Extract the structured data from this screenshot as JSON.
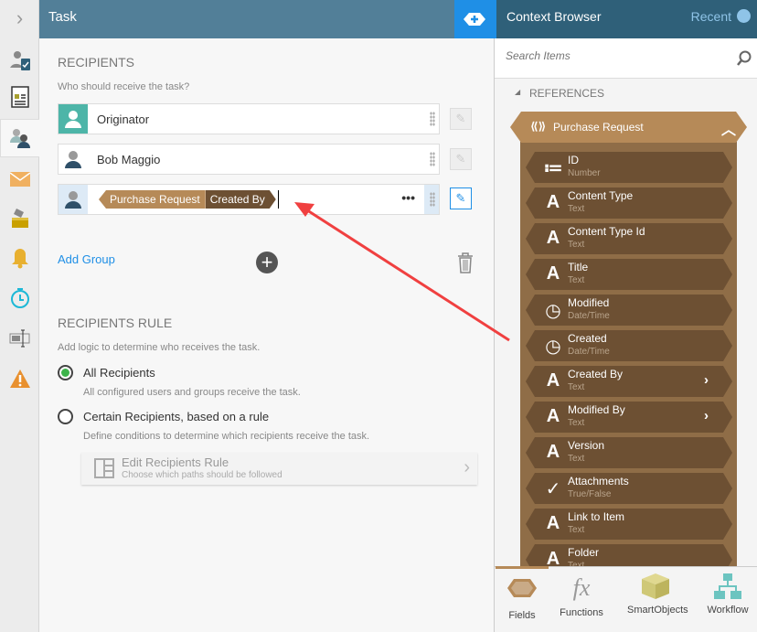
{
  "rail": {
    "icons": [
      "chevron-right-icon",
      "user-task-icon",
      "form-icon",
      "recipients-icon",
      "email-icon",
      "escalation-icon",
      "notification-bell-icon",
      "timer-icon",
      "text-field-icon",
      "warning-icon"
    ]
  },
  "task": {
    "title": "Task",
    "recipients": {
      "heading": "RECIPIENTS",
      "subtitle": "Who should receive the task?",
      "rows": [
        {
          "label": "Originator"
        },
        {
          "label": "Bob Maggio"
        },
        {
          "token_parent": "Purchase Request",
          "token_child": "Created By"
        }
      ],
      "add_group": "Add Group"
    },
    "rule": {
      "heading": "RECIPIENTS RULE",
      "subtitle": "Add logic to determine who receives the task.",
      "options": [
        {
          "label": "All Recipients",
          "desc": "All configured users and groups receive the task.",
          "selected": true
        },
        {
          "label": "Certain Recipients, based on a rule",
          "desc": "Define conditions to determine which recipients receive the task.",
          "selected": false
        }
      ],
      "edit_title": "Edit Recipients Rule",
      "edit_sub": "Choose which paths should be followed"
    }
  },
  "context": {
    "title": "Context Browser",
    "recent": "Recent",
    "search_placeholder": "Search Items",
    "references": "REFERENCES",
    "group": "Purchase Request",
    "items": [
      {
        "name": "ID",
        "type": "Number",
        "icon": "number-list-icon"
      },
      {
        "name": "Content Type",
        "type": "Text",
        "icon": "text-icon"
      },
      {
        "name": "Content Type Id",
        "type": "Text",
        "icon": "text-icon"
      },
      {
        "name": "Title",
        "type": "Text",
        "icon": "text-icon"
      },
      {
        "name": "Modified",
        "type": "Date/Time",
        "icon": "datetime-icon"
      },
      {
        "name": "Created",
        "type": "Date/Time",
        "icon": "datetime-icon"
      },
      {
        "name": "Created By",
        "type": "Text",
        "icon": "text-icon",
        "expandable": true
      },
      {
        "name": "Modified By",
        "type": "Text",
        "icon": "text-icon",
        "expandable": true
      },
      {
        "name": "Version",
        "type": "Text",
        "icon": "text-icon"
      },
      {
        "name": "Attachments",
        "type": "True/False",
        "icon": "boolean-icon"
      },
      {
        "name": "Link to Item",
        "type": "Text",
        "icon": "text-icon"
      },
      {
        "name": "Folder",
        "type": "Text",
        "icon": "text-icon"
      }
    ],
    "tabs": [
      {
        "label": "Fields",
        "active": true
      },
      {
        "label": "Functions"
      },
      {
        "label": "SmartObjects"
      },
      {
        "label": "Workflow"
      }
    ]
  },
  "colors": {
    "header": "#527f98",
    "context_header": "#2f6079",
    "accent": "#1f8fe6",
    "reference_tan": "#b68a58",
    "item_brown": "#6d5033",
    "arrow": "#f04040"
  }
}
